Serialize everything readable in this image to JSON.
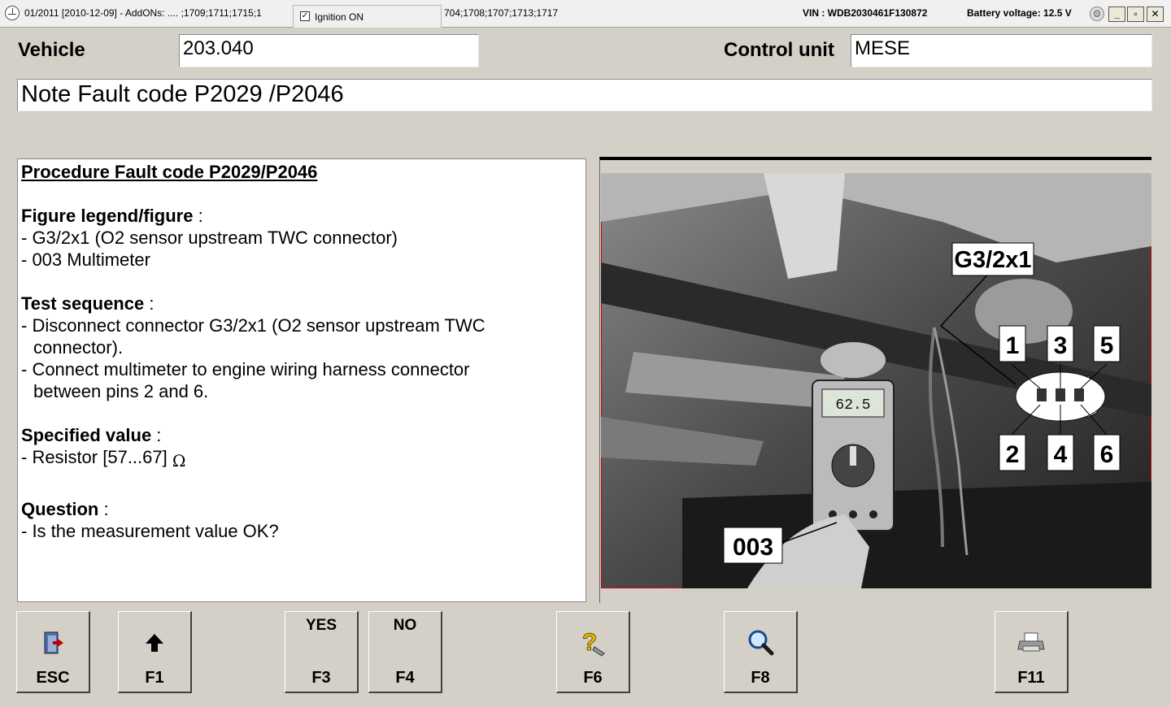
{
  "titlebar": {
    "left_text": "01/2011 [2010-12-09] - AddONs:  .... ;1709;1711;1715;1",
    "ignition_label": "Ignition ON",
    "ignition_checked": true,
    "mid_text": "704;1708;1707;1713;1717",
    "vin": "VIN : WDB2030461F130872",
    "battery": "Battery voltage: 12.5 V",
    "minimize": "_",
    "restore": "▫",
    "close": "✕"
  },
  "vehicle": {
    "label": "Vehicle",
    "value": "203.040"
  },
  "control_unit": {
    "label": "Control unit",
    "value": "MESE"
  },
  "note": "Note Fault code P2029 /P2046",
  "procedure": {
    "title": "Procedure Fault code P2029/P2046",
    "legend_heading": "Figure legend/figure",
    "legend_items": [
      "- G3/2x1 (O2 sensor upstream TWC connector)",
      "- 003 Multimeter"
    ],
    "test_heading": "Test sequence",
    "test_items": [
      "- Disconnect connector G3/2x1 (O2 sensor upstream TWC",
      "connector).",
      "- Connect multimeter to engine wiring harness connector",
      "between pins 2 and 6."
    ],
    "spec_heading": "Specified value",
    "spec_item": "- Resistor [57...67]",
    "spec_unit": "Ω",
    "question_heading": "Question",
    "question_item": "- Is the measurement value OK?",
    "colon": " :"
  },
  "figure": {
    "connector_label": "G3/2x1",
    "pins_top": [
      "1",
      "3",
      "5"
    ],
    "pins_bottom": [
      "2",
      "4",
      "6"
    ],
    "multimeter_label": "003",
    "meter_display": "62.5"
  },
  "fkeys": [
    {
      "top": "",
      "key": "ESC",
      "icon": "exit-door-icon"
    },
    {
      "top": "",
      "key": "F1",
      "icon": "arrow-up-icon"
    },
    {
      "top": "YES",
      "key": "F3",
      "icon": ""
    },
    {
      "top": "NO",
      "key": "F4",
      "icon": ""
    },
    {
      "top": "",
      "key": "F6",
      "icon": "help-question-icon"
    },
    {
      "top": "",
      "key": "F8",
      "icon": "magnifier-icon"
    },
    {
      "top": "",
      "key": "F11",
      "icon": "printer-icon"
    }
  ],
  "colors": {
    "background": "#d4d0c8",
    "image_border": "#d00000",
    "help_icon": "#f0c000"
  }
}
